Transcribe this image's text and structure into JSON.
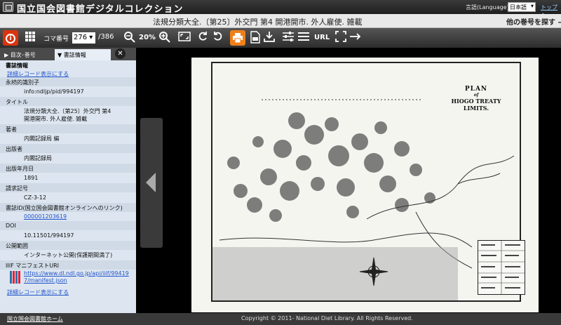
{
  "app": {
    "site_title": "国立国会図書館デジタルコレクション",
    "language_label": "言語(Language):",
    "language_value": "日本語",
    "top_link": "トップへ"
  },
  "titlebar": {
    "doc_title": "法規分類大全.〔第25〕外交門 第4 開港開市. 外人雇使. 雑載",
    "other_volume": "他の巻号を探す →"
  },
  "toolbar": {
    "koma_label": "コマ番号",
    "page_value": "276 ▾",
    "page_total": "/386",
    "zoom_value": "20%",
    "url_label": "URL"
  },
  "panel": {
    "tab_toc": "目次･巻号",
    "tab_info": "書誌情報",
    "section_title": "書誌情報",
    "detail_link": "詳細レコード表示にする",
    "rows": [
      {
        "label": "永続的識別子",
        "value": "info:ndljp/pid/994197"
      },
      {
        "label": "タイトル",
        "value": "法規分類大全.〔第25〕外交門 第4 開港開市. 外人雇使. 雑載"
      },
      {
        "label": "著者",
        "value": "内閣記録局 編"
      },
      {
        "label": "出版者",
        "value": "内閣記録局"
      },
      {
        "label": "出版年月日",
        "value": "1891"
      },
      {
        "label": "請求記号",
        "value": "CZ-3-12"
      },
      {
        "label": "書誌ID(国立国会図書館オンラインへのリンク)",
        "value": "000001203619"
      },
      {
        "label": "DOI",
        "value": "10.11501/994197"
      },
      {
        "label": "公開範囲",
        "value": "インターネット公開(保護期間満了)"
      },
      {
        "label": "IIIF マニフェストURI",
        "value": "https://www.dl.ndl.go.jp/api/iiif/994197/manifest.json"
      }
    ],
    "bottom_link": "詳細レコード表示にする"
  },
  "map": {
    "title_line1": "PLAN",
    "title_line2": "of",
    "title_line3": "HIOGO TREATY",
    "title_line4": "LIMITS."
  },
  "footer": {
    "home_link": "国立国会図書館ホーム",
    "copyright": "Copyright © 2011- National Diet Library. All Rights Reserved."
  },
  "colors": {
    "info_button": "#d9340f",
    "print_button": "#f07f1a",
    "panel_bg": "#dde6f0",
    "link": "#2255cc"
  }
}
